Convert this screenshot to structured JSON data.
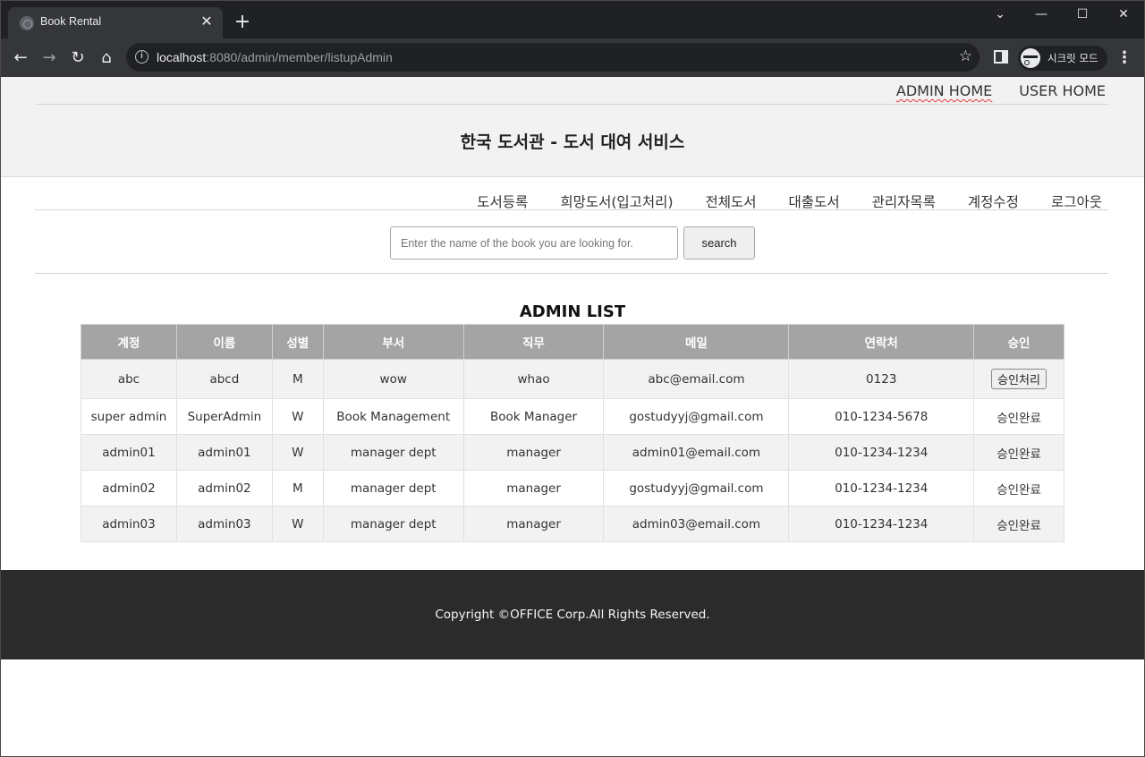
{
  "browser": {
    "tab_title": "Book Rental",
    "url_host": "localhost",
    "url_path": ":8080/admin/member/listupAdmin",
    "incognito_label": "시크릿 모드"
  },
  "header": {
    "links": [
      "ADMIN HOME",
      "USER HOME"
    ],
    "title": "한국 도서관 - 도서 대여 서비스"
  },
  "menu": [
    "도서등록",
    "희망도서(입고처리)",
    "전체도서",
    "대출도서",
    "관리자목록",
    "계정수정",
    "로그아웃"
  ],
  "search": {
    "placeholder": "Enter the name of the book you are looking for.",
    "button": "search"
  },
  "admin_list": {
    "title": "ADMIN LIST",
    "columns": [
      "계정",
      "이름",
      "성별",
      "부서",
      "직무",
      "메일",
      "연락처",
      "승인"
    ],
    "rows": [
      {
        "account": "abc",
        "name": "abcd",
        "gender": "M",
        "dept": "wow",
        "job": "whao",
        "email": "abc@email.com",
        "phone": "0123",
        "approval": "승인처리",
        "approval_is_button": true
      },
      {
        "account": "super admin",
        "name": "SuperAdmin",
        "gender": "W",
        "dept": "Book Management",
        "job": "Book Manager",
        "email": "gostudyyj@gmail.com",
        "phone": "010-1234-5678",
        "approval": "승인완료",
        "approval_is_button": false
      },
      {
        "account": "admin01",
        "name": "admin01",
        "gender": "W",
        "dept": "manager dept",
        "job": "manager",
        "email": "admin01@email.com",
        "phone": "010-1234-1234",
        "approval": "승인완료",
        "approval_is_button": false
      },
      {
        "account": "admin02",
        "name": "admin02",
        "gender": "M",
        "dept": "manager dept",
        "job": "manager",
        "email": "gostudyyj@gmail.com",
        "phone": "010-1234-1234",
        "approval": "승인완료",
        "approval_is_button": false
      },
      {
        "account": "admin03",
        "name": "admin03",
        "gender": "W",
        "dept": "manager dept",
        "job": "manager",
        "email": "admin03@email.com",
        "phone": "010-1234-1234",
        "approval": "승인완료",
        "approval_is_button": false
      }
    ]
  },
  "footer": {
    "copyright": "Copyright ©OFFICE Corp.All Rights Reserved."
  }
}
